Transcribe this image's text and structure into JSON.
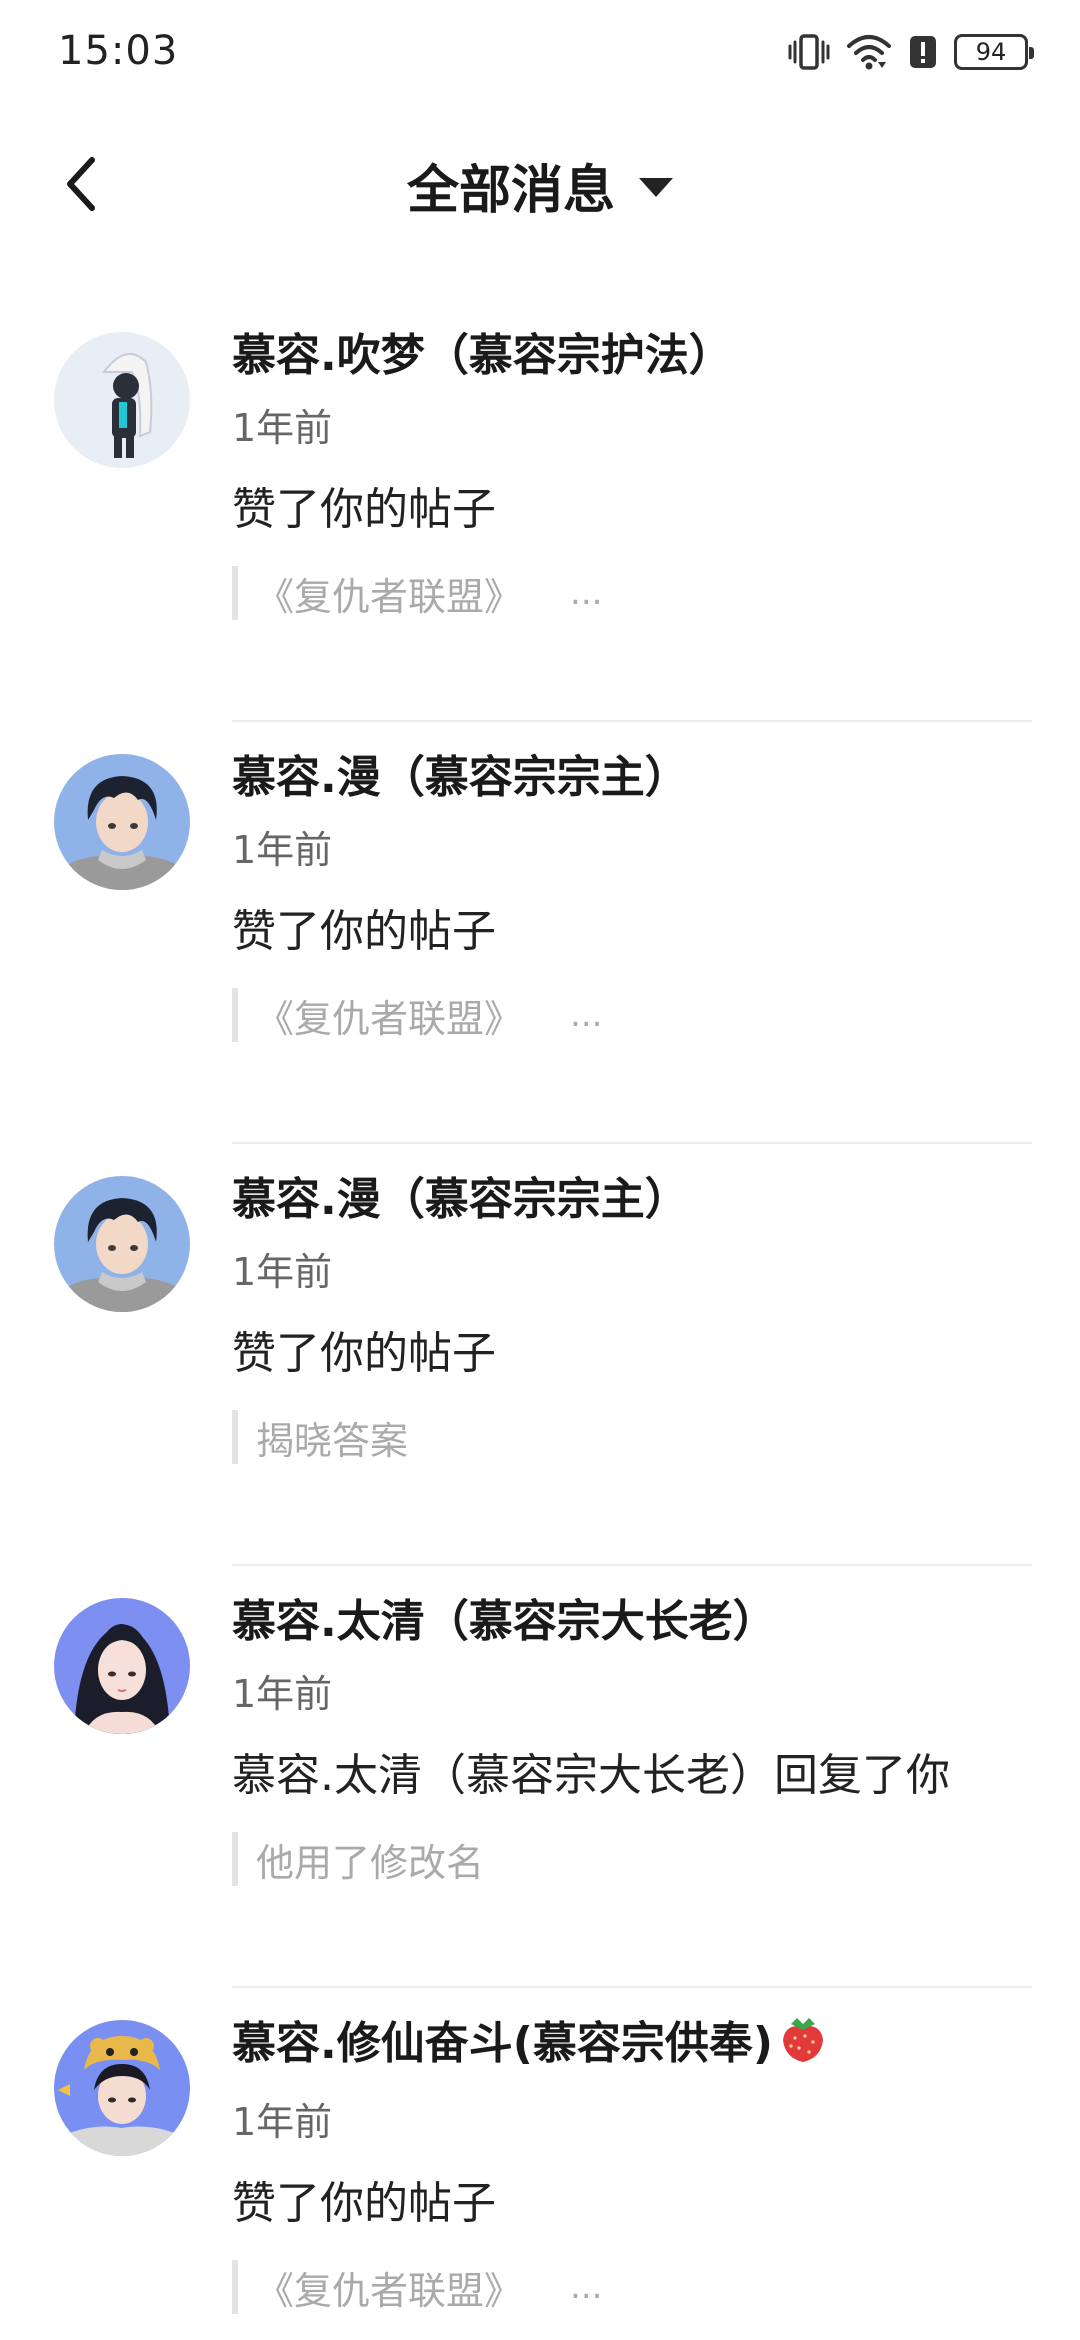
{
  "status_bar": {
    "time": "15:03",
    "battery": "94",
    "icons": [
      "vibrate-icon",
      "wifi-icon",
      "alert-icon",
      "battery-icon"
    ]
  },
  "header": {
    "back_icon": "chevron-left-icon",
    "title": "全部消息",
    "dropdown_icon": "caret-down-icon"
  },
  "messages": [
    {
      "name": "慕容.吹梦（慕容宗护法）",
      "time": "1年前",
      "action": "赞了你的帖子",
      "quote": "《复仇者联盟》",
      "quote_more": "...",
      "avatar_bg": "#e8eef5"
    },
    {
      "name": "慕容.漫（慕容宗宗主）",
      "time": "1年前",
      "action": "赞了你的帖子",
      "quote": "《复仇者联盟》",
      "quote_more": "...",
      "avatar_bg": "#8fb3e8"
    },
    {
      "name": "慕容.漫（慕容宗宗主）",
      "time": "1年前",
      "action": "赞了你的帖子",
      "quote": "揭晓答案",
      "quote_more": "",
      "avatar_bg": "#8fb3e8"
    },
    {
      "name": "慕容.太清（慕容宗大长老）",
      "time": "1年前",
      "action": "慕容.太清（慕容宗大长老）回复了你",
      "quote": "他用了修改名",
      "quote_more": "",
      "avatar_bg": "#7d8ff0"
    },
    {
      "name": "慕容.修仙奋斗(慕容宗供奉)",
      "name_emoji": "strawberry-icon",
      "time": "1年前",
      "action": "赞了你的帖子",
      "quote": "《复仇者联盟》",
      "quote_more": "...",
      "avatar_bg": "#7a8ff2"
    }
  ]
}
